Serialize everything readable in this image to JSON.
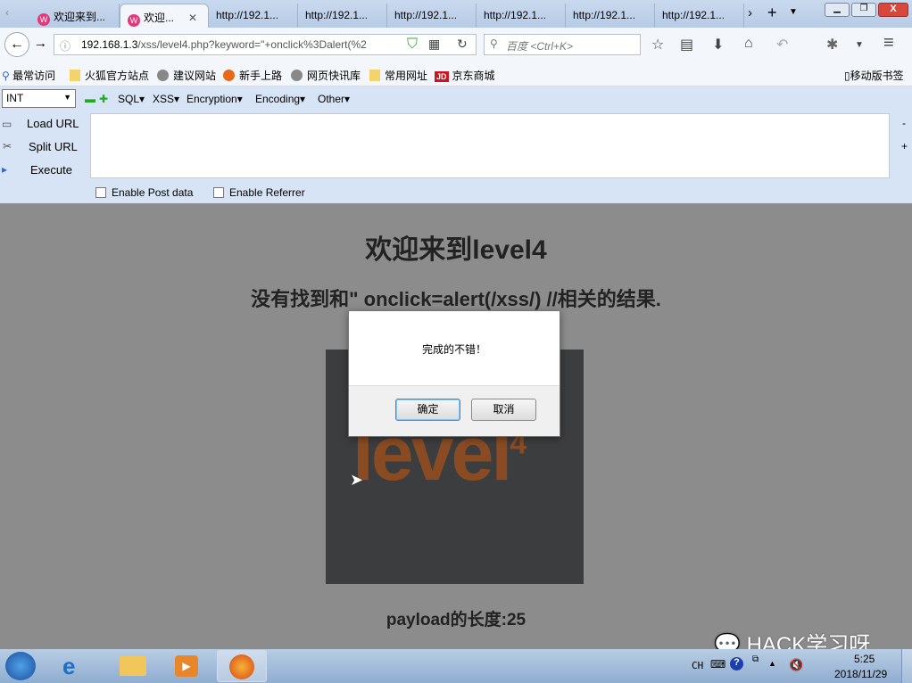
{
  "tabs": [
    {
      "label": "欢迎来到...",
      "icon": "wamp-icon"
    },
    {
      "label": "欢迎...",
      "icon": "wamp-icon",
      "active": true
    },
    {
      "label": "http://192.1..."
    },
    {
      "label": "http://192.1..."
    },
    {
      "label": "http://192.1..."
    },
    {
      "label": "http://192.1..."
    },
    {
      "label": "http://192.1..."
    },
    {
      "label": "http://192.1..."
    }
  ],
  "url": {
    "host": "192.168.1.3",
    "path": "/xss/level4.php?keyword=\"+onclick%3Dalert(%2"
  },
  "search": {
    "placeholder": "百度 <Ctrl+K>"
  },
  "bookmarks": [
    "最常访问",
    "火狐官方站点",
    "建议网站",
    "新手上路",
    "网页快讯库",
    "常用网址",
    "京东商城"
  ],
  "mobile_bookmarks": "移动版书签",
  "hackbar": {
    "select": "INT",
    "menus": [
      "SQL▾",
      "XSS▾",
      "Encryption▾",
      "Encoding▾",
      "Other▾"
    ],
    "load": "Load URL",
    "split": "Split URL",
    "execute": "Execute",
    "post": "Enable Post data",
    "referrer": "Enable Referrer",
    "minus": "-",
    "plus": "+"
  },
  "page": {
    "title": "欢迎来到level4",
    "result": "没有找到和\" onclick=alert(/xss/) //相关的结果.",
    "logo": "level4",
    "payload": "payload的长度:25"
  },
  "dialog": {
    "message": "完成的不错！",
    "ok": "确定",
    "cancel": "取消"
  },
  "taskbar": {
    "lang": "CH",
    "time": "5:25",
    "date": "2018/11/29"
  },
  "watermark": "HACK学习呀",
  "colors": {
    "logo": "#8a4b22",
    "page_bg": "#8c8c8c",
    "hackbar_bg": "#d6e4f5"
  }
}
